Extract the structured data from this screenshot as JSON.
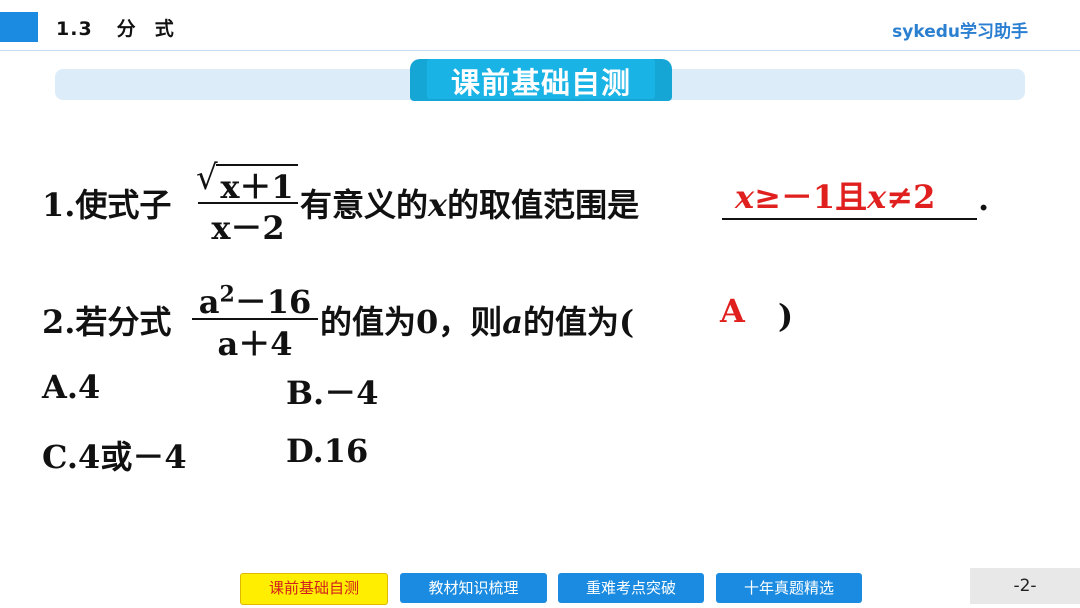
{
  "header": {
    "section_number": "1.3",
    "section_title_1": "分",
    "section_title_2": "式",
    "brand": "sykedu学习助手"
  },
  "title": "课前基础自测",
  "q1": {
    "prefix": "1.使式子",
    "num_x": "x",
    "num_rest": "＋1",
    "den_x": "x",
    "den_rest": "－2",
    "mid_1": "有意义的",
    "mid_x": "x",
    "mid_2": "的取值范围是",
    "ans_x1": "x",
    "ans_mid": "≥－1且",
    "ans_x2": "x",
    "ans_end": "≠2",
    "end": "."
  },
  "q2": {
    "prefix": "2.若分式",
    "num_a": "a",
    "num_sup": "2",
    "num_rest": "－16",
    "den_a": "a",
    "den_rest": "＋4",
    "mid_1": "的值为0，则",
    "mid_a": "a",
    "mid_2": "的值为(",
    "answer": "A",
    "close": ")"
  },
  "options": {
    "A": "A.4",
    "B": "B.－4",
    "C": "C.4或－4",
    "D": "D.16"
  },
  "nav": {
    "btn1": "课前基础自测",
    "btn2": "教材知识梳理",
    "btn3": "重难考点突破",
    "btn4": "十年真题精选"
  },
  "page": "-2-",
  "colors": {
    "accent_blue": "#1a8be0",
    "title_cyan": "#1ab3e6",
    "answer_red": "#e0201e",
    "active_yellow": "#ffee00"
  }
}
